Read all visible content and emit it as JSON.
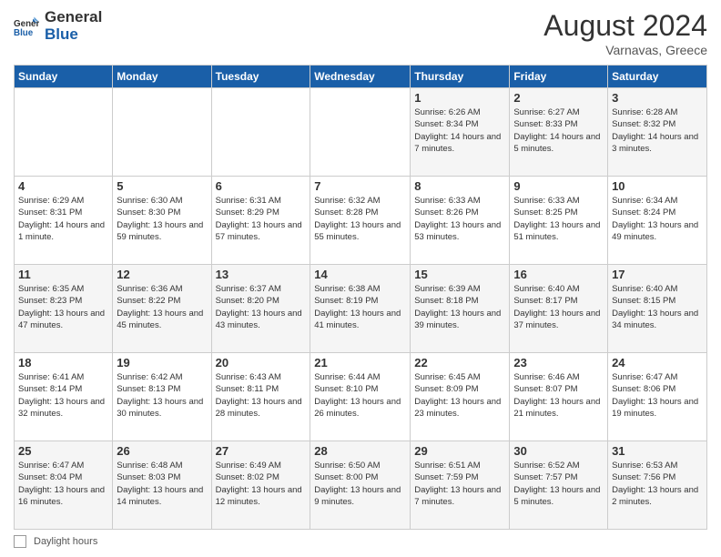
{
  "header": {
    "logo_general": "General",
    "logo_blue": "Blue",
    "month_year": "August 2024",
    "location": "Varnavas, Greece"
  },
  "days_of_week": [
    "Sunday",
    "Monday",
    "Tuesday",
    "Wednesday",
    "Thursday",
    "Friday",
    "Saturday"
  ],
  "footer": {
    "box_label": "Daylight hours"
  },
  "weeks": [
    [
      {
        "day": "",
        "info": ""
      },
      {
        "day": "",
        "info": ""
      },
      {
        "day": "",
        "info": ""
      },
      {
        "day": "",
        "info": ""
      },
      {
        "day": "1",
        "info": "Sunrise: 6:26 AM\nSunset: 8:34 PM\nDaylight: 14 hours and 7 minutes."
      },
      {
        "day": "2",
        "info": "Sunrise: 6:27 AM\nSunset: 8:33 PM\nDaylight: 14 hours and 5 minutes."
      },
      {
        "day": "3",
        "info": "Sunrise: 6:28 AM\nSunset: 8:32 PM\nDaylight: 14 hours and 3 minutes."
      }
    ],
    [
      {
        "day": "4",
        "info": "Sunrise: 6:29 AM\nSunset: 8:31 PM\nDaylight: 14 hours and 1 minute."
      },
      {
        "day": "5",
        "info": "Sunrise: 6:30 AM\nSunset: 8:30 PM\nDaylight: 13 hours and 59 minutes."
      },
      {
        "day": "6",
        "info": "Sunrise: 6:31 AM\nSunset: 8:29 PM\nDaylight: 13 hours and 57 minutes."
      },
      {
        "day": "7",
        "info": "Sunrise: 6:32 AM\nSunset: 8:28 PM\nDaylight: 13 hours and 55 minutes."
      },
      {
        "day": "8",
        "info": "Sunrise: 6:33 AM\nSunset: 8:26 PM\nDaylight: 13 hours and 53 minutes."
      },
      {
        "day": "9",
        "info": "Sunrise: 6:33 AM\nSunset: 8:25 PM\nDaylight: 13 hours and 51 minutes."
      },
      {
        "day": "10",
        "info": "Sunrise: 6:34 AM\nSunset: 8:24 PM\nDaylight: 13 hours and 49 minutes."
      }
    ],
    [
      {
        "day": "11",
        "info": "Sunrise: 6:35 AM\nSunset: 8:23 PM\nDaylight: 13 hours and 47 minutes."
      },
      {
        "day": "12",
        "info": "Sunrise: 6:36 AM\nSunset: 8:22 PM\nDaylight: 13 hours and 45 minutes."
      },
      {
        "day": "13",
        "info": "Sunrise: 6:37 AM\nSunset: 8:20 PM\nDaylight: 13 hours and 43 minutes."
      },
      {
        "day": "14",
        "info": "Sunrise: 6:38 AM\nSunset: 8:19 PM\nDaylight: 13 hours and 41 minutes."
      },
      {
        "day": "15",
        "info": "Sunrise: 6:39 AM\nSunset: 8:18 PM\nDaylight: 13 hours and 39 minutes."
      },
      {
        "day": "16",
        "info": "Sunrise: 6:40 AM\nSunset: 8:17 PM\nDaylight: 13 hours and 37 minutes."
      },
      {
        "day": "17",
        "info": "Sunrise: 6:40 AM\nSunset: 8:15 PM\nDaylight: 13 hours and 34 minutes."
      }
    ],
    [
      {
        "day": "18",
        "info": "Sunrise: 6:41 AM\nSunset: 8:14 PM\nDaylight: 13 hours and 32 minutes."
      },
      {
        "day": "19",
        "info": "Sunrise: 6:42 AM\nSunset: 8:13 PM\nDaylight: 13 hours and 30 minutes."
      },
      {
        "day": "20",
        "info": "Sunrise: 6:43 AM\nSunset: 8:11 PM\nDaylight: 13 hours and 28 minutes."
      },
      {
        "day": "21",
        "info": "Sunrise: 6:44 AM\nSunset: 8:10 PM\nDaylight: 13 hours and 26 minutes."
      },
      {
        "day": "22",
        "info": "Sunrise: 6:45 AM\nSunset: 8:09 PM\nDaylight: 13 hours and 23 minutes."
      },
      {
        "day": "23",
        "info": "Sunrise: 6:46 AM\nSunset: 8:07 PM\nDaylight: 13 hours and 21 minutes."
      },
      {
        "day": "24",
        "info": "Sunrise: 6:47 AM\nSunset: 8:06 PM\nDaylight: 13 hours and 19 minutes."
      }
    ],
    [
      {
        "day": "25",
        "info": "Sunrise: 6:47 AM\nSunset: 8:04 PM\nDaylight: 13 hours and 16 minutes."
      },
      {
        "day": "26",
        "info": "Sunrise: 6:48 AM\nSunset: 8:03 PM\nDaylight: 13 hours and 14 minutes."
      },
      {
        "day": "27",
        "info": "Sunrise: 6:49 AM\nSunset: 8:02 PM\nDaylight: 13 hours and 12 minutes."
      },
      {
        "day": "28",
        "info": "Sunrise: 6:50 AM\nSunset: 8:00 PM\nDaylight: 13 hours and 9 minutes."
      },
      {
        "day": "29",
        "info": "Sunrise: 6:51 AM\nSunset: 7:59 PM\nDaylight: 13 hours and 7 minutes."
      },
      {
        "day": "30",
        "info": "Sunrise: 6:52 AM\nSunset: 7:57 PM\nDaylight: 13 hours and 5 minutes."
      },
      {
        "day": "31",
        "info": "Sunrise: 6:53 AM\nSunset: 7:56 PM\nDaylight: 13 hours and 2 minutes."
      }
    ]
  ]
}
